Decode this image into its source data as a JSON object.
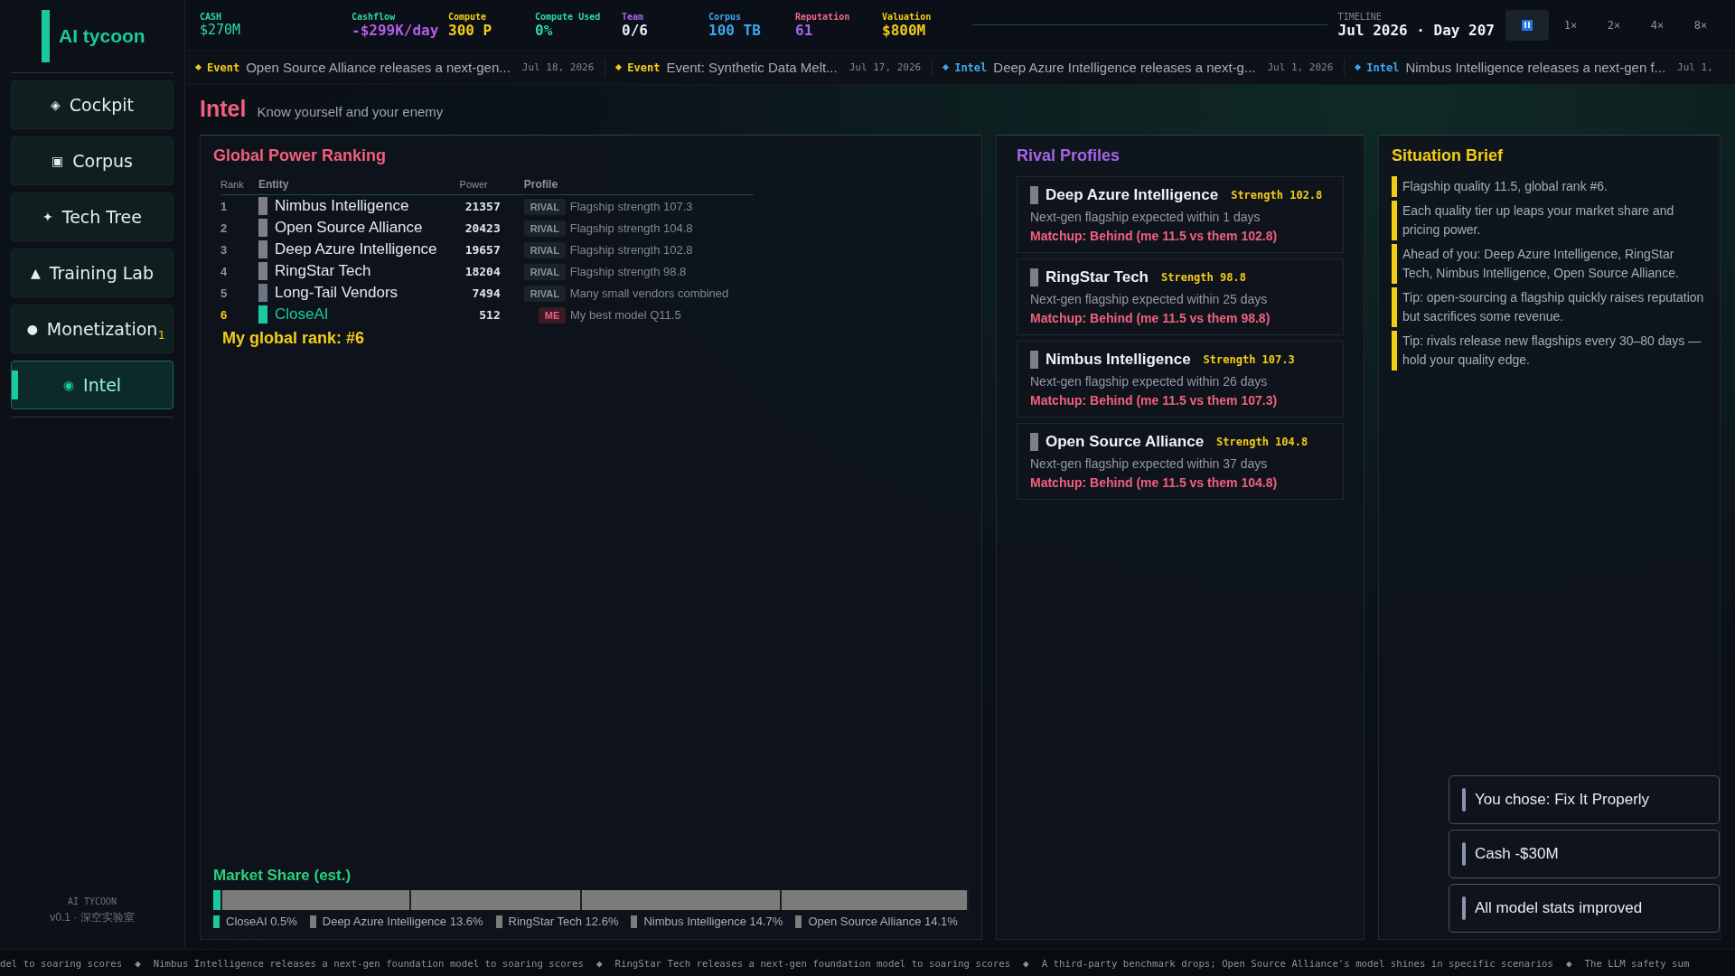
{
  "sidebar": {
    "logo": "AI tycoon",
    "items": [
      {
        "icon": "◈",
        "label": "Cockpit",
        "selected": false
      },
      {
        "icon": "▣",
        "label": "Corpus",
        "selected": false
      },
      {
        "icon": "✦",
        "label": "Tech Tree",
        "selected": false
      },
      {
        "icon": "▲",
        "label": "Training Lab",
        "selected": false
      },
      {
        "icon": "●",
        "label": "Monetization",
        "badge": "1",
        "selected": false
      },
      {
        "icon": "◉",
        "label": "Intel",
        "selected": true
      }
    ],
    "footer_title": "AI TYCOON",
    "footer_version": "v0.1 · 深空实验室"
  },
  "stats": [
    {
      "kind": "cash",
      "label": "CASH",
      "value": "$270M"
    },
    {
      "kind": "cashflow",
      "label": "Cashflow",
      "value": "-$299K/day"
    },
    {
      "kind": "compute",
      "label": "Compute",
      "value": "300 P"
    },
    {
      "kind": "compute_used",
      "label": "Compute Used",
      "value": "0%"
    },
    {
      "kind": "team",
      "label": "Team",
      "value": "0/6"
    },
    {
      "kind": "corpus",
      "label": "Corpus",
      "value": "100 TB"
    },
    {
      "kind": "reputation",
      "label": "Reputation",
      "value": "61"
    },
    {
      "kind": "valuation",
      "label": "Valuation",
      "value": "$800M"
    }
  ],
  "timeline": {
    "label": "TIMELINE",
    "value": "Jul 2026 · Day 207"
  },
  "speed_controls": [
    {
      "kind": "pause",
      "selected": true
    },
    {
      "kind": "speed",
      "label": "1×",
      "selected": false
    },
    {
      "kind": "speed",
      "label": "2×",
      "selected": false
    },
    {
      "kind": "speed",
      "label": "4×",
      "selected": false
    },
    {
      "kind": "speed",
      "label": "8×",
      "selected": false
    }
  ],
  "news_strip": [
    {
      "kind": "event",
      "tag": "Event",
      "text": "Open Source Alliance releases a next-gen...",
      "date": "Jul 18, 2026"
    },
    {
      "kind": "event",
      "tag": "Event",
      "text": "Event: Synthetic Data Melt...",
      "date": "Jul 17, 2026"
    },
    {
      "kind": "intel",
      "tag": "Intel",
      "text": "Deep Azure Intelligence releases a next-g...",
      "date": "Jul 1, 2026"
    },
    {
      "kind": "intel",
      "tag": "Intel",
      "text": "Nimbus Intelligence releases a next-gen f...",
      "date": "Jul 1,"
    }
  ],
  "page": {
    "title": "Intel",
    "subtitle": "Know yourself and your enemy"
  },
  "ranking": {
    "title": "Global Power Ranking",
    "columns": [
      "Rank",
      "Entity",
      "Power",
      "Profile"
    ],
    "rows": [
      {
        "kind": "rival",
        "rank": "1",
        "color": "#7c7f86",
        "entity": "Nimbus Intelligence",
        "power": "21357",
        "tag": "RIVAL",
        "profile": "Flagship strength 107.3"
      },
      {
        "kind": "rival",
        "rank": "2",
        "color": "#7c7f86",
        "entity": "Open Source Alliance",
        "power": "20423",
        "tag": "RIVAL",
        "profile": "Flagship strength 104.8"
      },
      {
        "kind": "rival",
        "rank": "3",
        "color": "#7c7f86",
        "entity": "Deep Azure Intelligence",
        "power": "19657",
        "tag": "RIVAL",
        "profile": "Flagship strength 102.8"
      },
      {
        "kind": "rival",
        "rank": "4",
        "color": "#7c7f86",
        "entity": "RingStar Tech",
        "power": "18204",
        "tag": "RIVAL",
        "profile": "Flagship strength 98.8"
      },
      {
        "kind": "rival",
        "rank": "5",
        "color": "#6d7584",
        "entity": "Long-Tail Vendors",
        "power": "7494",
        "tag": "RIVAL",
        "profile": "Many small vendors combined"
      },
      {
        "kind": "me",
        "rank": "6",
        "color": "#19c9a0",
        "entity": "CloseAI",
        "power": "512",
        "tag": "ME",
        "profile": "My best model Q11.5"
      }
    ],
    "my_rank": "My global rank: #6"
  },
  "market_share": {
    "title": "Market Share (est.)",
    "segments": [
      {
        "label": "CloseAI 0.5%",
        "color": "#19c9a0"
      },
      {
        "label": "Deep Azure Intelligence 13.6%",
        "color": "#7c7c7c"
      },
      {
        "label": "RingStar Tech 12.6%",
        "color": "#7c7c7c"
      },
      {
        "label": "Nimbus Intelligence 14.7%",
        "color": "#7c7c7c"
      },
      {
        "label": "Open Source Alliance 14.1%",
        "color": "#7c7c7c"
      }
    ]
  },
  "rival_profiles": {
    "title": "Rival Profiles",
    "cards": [
      {
        "name": "Deep Azure Intelligence",
        "strength": "Strength 102.8",
        "expected": "Next-gen flagship expected within 1 days",
        "matchup": "Matchup: Behind (me 11.5 vs them 102.8)"
      },
      {
        "name": "RingStar Tech",
        "strength": "Strength 98.8",
        "expected": "Next-gen flagship expected within 25 days",
        "matchup": "Matchup: Behind (me 11.5 vs them 98.8)"
      },
      {
        "name": "Nimbus Intelligence",
        "strength": "Strength 107.3",
        "expected": "Next-gen flagship expected within 26 days",
        "matchup": "Matchup: Behind (me 11.5 vs them 107.3)"
      },
      {
        "name": "Open Source Alliance",
        "strength": "Strength 104.8",
        "expected": "Next-gen flagship expected within 37 days",
        "matchup": "Matchup: Behind (me 11.5 vs them 104.8)"
      }
    ]
  },
  "situation_brief": {
    "title": "Situation Brief",
    "items": [
      "Flagship quality 11.5, global rank #6.",
      "Each quality tier up leaps your market share and pricing power.",
      "Ahead of you: Deep Azure Intelligence, RingStar Tech, Nimbus Intelligence, Open Source Alliance.",
      "Tip: open-sourcing a flagship quickly raises reputation but sacrifices some revenue.",
      "Tip: rivals release new flagships every 30–80 days — hold your quality edge."
    ]
  },
  "toasts": [
    "You chose: Fix It Properly",
    "Cash -$30M",
    "All model stats improved"
  ],
  "ticker": [
    {
      "text": "del to soaring scores"
    },
    {
      "mark": "◆",
      "text": "Nimbus Intelligence releases a next-gen foundation model to soaring scores"
    },
    {
      "mark": "◆",
      "text": "RingStar Tech releases a next-gen foundation model to soaring scores"
    },
    {
      "mark": "◆",
      "text": "A third-party benchmark drops; Open Source Alliance's model shines in specific scenarios"
    },
    {
      "mark": "◆",
      "text": "The LLM safety sum"
    }
  ]
}
